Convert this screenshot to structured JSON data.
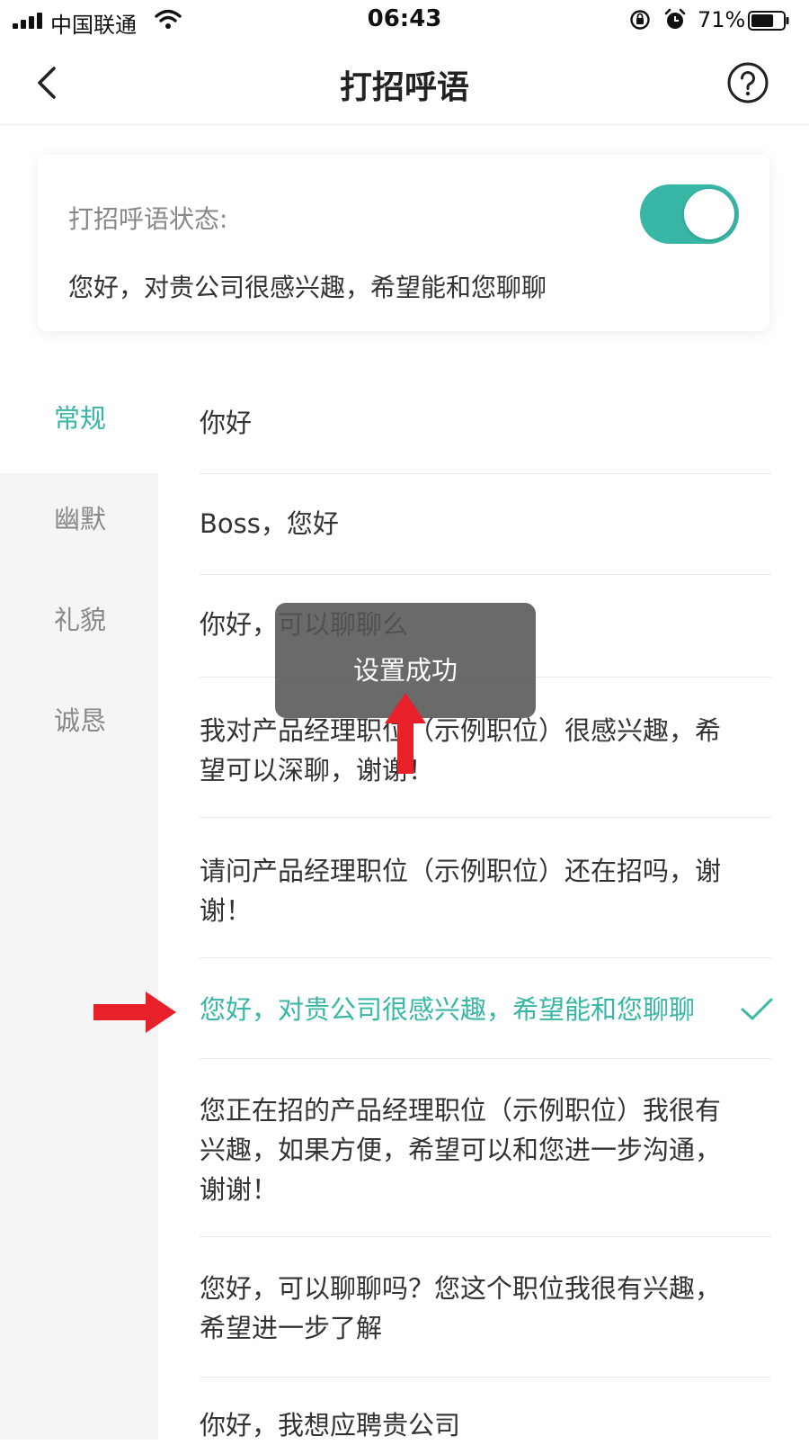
{
  "status_bar": {
    "carrier": "中国联通",
    "time": "06:43",
    "battery": "71%",
    "battery_level": 0.71
  },
  "nav": {
    "title": "打招呼语"
  },
  "status_card": {
    "label": "打招呼语状态:",
    "enabled": true,
    "current_message": "您好，对贵公司很感兴趣，希望能和您聊聊"
  },
  "categories": [
    {
      "label": "常规",
      "active": true
    },
    {
      "label": "幽默",
      "active": false
    },
    {
      "label": "礼貌",
      "active": false
    },
    {
      "label": "诚恳",
      "active": false
    }
  ],
  "greetings": [
    "你好",
    "Boss，您好",
    "你好，可以聊聊么",
    "我对产品经理职位（示例职位）很感兴趣，希望可以深聊，谢谢！",
    "请问产品经理职位（示例职位）还在招吗，谢谢！",
    "您好，对贵公司很感兴趣，希望能和您聊聊",
    "您正在招的产品经理职位（示例职位）我很有兴趣，如果方便，希望可以和您进一步沟通，谢谢！",
    "您好，可以聊聊吗？您这个职位我很有兴趣，希望进一步了解",
    "你好，我想应聘贵公司"
  ],
  "selected_index": 5,
  "toast": {
    "text": "设置成功"
  },
  "colors": {
    "accent": "#39b7a6",
    "annotation": "#e8202a"
  }
}
